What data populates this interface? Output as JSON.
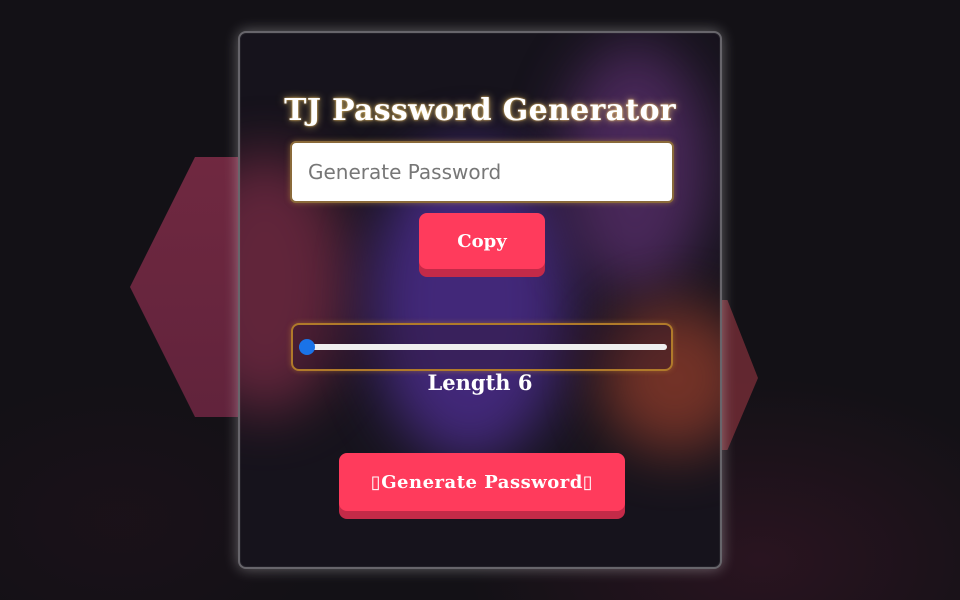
{
  "app": {
    "title": "TJ Password Generator"
  },
  "password_field": {
    "value": "",
    "placeholder": "Generate Password"
  },
  "copy_button": {
    "label": "Copy"
  },
  "length_slider": {
    "value": 6,
    "min": 4,
    "max": 100,
    "label": "Length 6"
  },
  "generate_button": {
    "label": "Generate Password",
    "icon_left": "sparkle-icon",
    "icon_right": "sparkle-icon"
  },
  "colors": {
    "accent": "#ff3b5c",
    "accent_shadow": "#c42a48",
    "slider": "#1a73e8",
    "background": "#131116"
  }
}
